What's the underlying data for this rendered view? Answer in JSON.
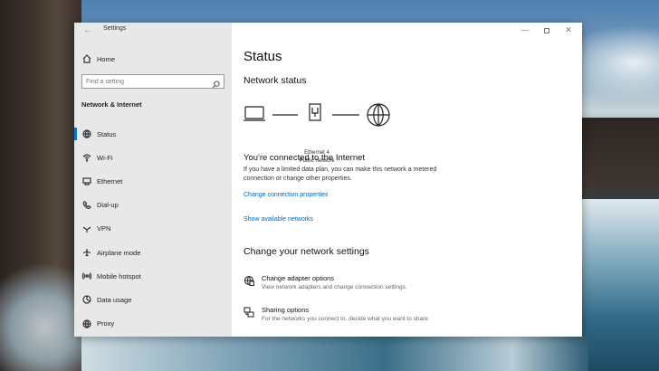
{
  "window": {
    "title": "Settings",
    "back_icon": "back-arrow-icon",
    "minimize_glyph": "—",
    "close_glyph": "✕"
  },
  "sidebar": {
    "home_label": "Home",
    "search_placeholder": "Find a setting",
    "section_label": "Network & Internet",
    "items": [
      {
        "label": "Status",
        "icon": "status-globe-icon",
        "active": true
      },
      {
        "label": "Wi-Fi",
        "icon": "wifi-icon",
        "active": false
      },
      {
        "label": "Ethernet",
        "icon": "ethernet-icon",
        "active": false
      },
      {
        "label": "Dial-up",
        "icon": "dialup-icon",
        "active": false
      },
      {
        "label": "VPN",
        "icon": "vpn-icon",
        "active": false
      },
      {
        "label": "Airplane mode",
        "icon": "airplane-icon",
        "active": false
      },
      {
        "label": "Mobile hotspot",
        "icon": "hotspot-icon",
        "active": false
      },
      {
        "label": "Data usage",
        "icon": "data-usage-icon",
        "active": false
      },
      {
        "label": "Proxy",
        "icon": "proxy-globe-icon",
        "active": false
      }
    ]
  },
  "main": {
    "page_title": "Status",
    "network_status_heading": "Network status",
    "diagram": {
      "adapter_name": "Ethernet 4",
      "network_type": "Public network"
    },
    "connection_title": "You're connected to the Internet",
    "connection_desc": "If you have a limited data plan, you can make this network a metered connection or change other properties.",
    "change_properties_link": "Change connection properties",
    "show_networks_link": "Show available networks",
    "change_settings_heading": "Change your network settings",
    "options": [
      {
        "title": "Change adapter options",
        "desc": "View network adapters and change connection settings.",
        "icon": "adapter-icon"
      },
      {
        "title": "Sharing options",
        "desc": "For the networks you connect to, decide what you want to share.",
        "icon": "sharing-icon"
      }
    ]
  },
  "colors": {
    "accent": "#0078d7",
    "link": "#0067b8",
    "sidebar_bg": "#e8e8e8"
  }
}
